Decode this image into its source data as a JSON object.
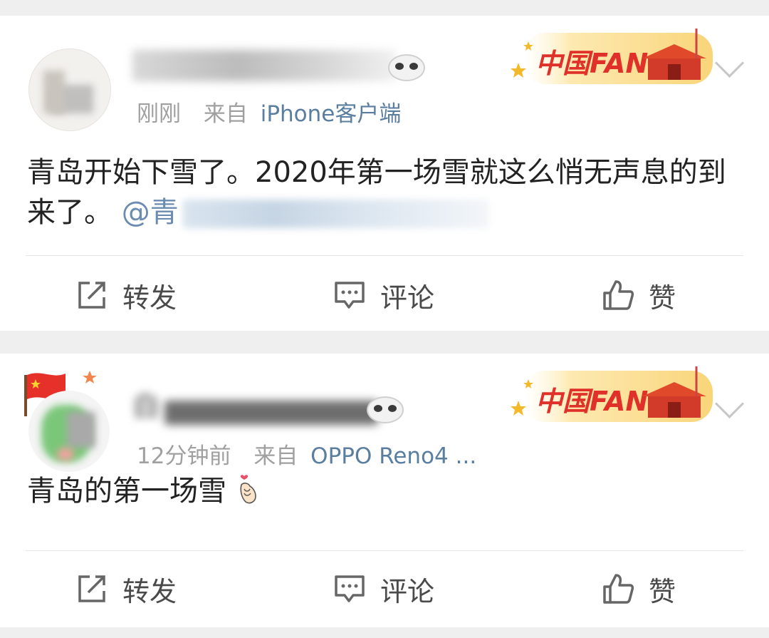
{
  "posts": [
    {
      "time": "刚刚",
      "source_prefix": "来自",
      "source": "iPhone客户端",
      "badge_text": "中国FANS",
      "content_text": "青岛开始下雪了。2020年第一场雪就这么悄无声息的到来了。",
      "mention_prefix": "@青",
      "actions": {
        "repost": "转发",
        "comment": "评论",
        "like": "赞"
      }
    },
    {
      "username_partial": "白",
      "time": "12分钟前",
      "source_prefix": "来自",
      "source": "OPPO Reno4 ...",
      "badge_text": "中国FANS",
      "content_text": "青岛的第一场雪",
      "actions": {
        "repost": "转发",
        "comment": "评论",
        "like": "赞"
      }
    }
  ],
  "colors": {
    "link": "#5a7ea0",
    "meta": "#a0a0a0",
    "badge_text": "#e0302a",
    "badge_bg": "#fbe2a0"
  },
  "icons": [
    "repost-icon",
    "comment-icon",
    "like-icon",
    "chevron-down-icon",
    "flag-icon",
    "heart-hand-emoji"
  ]
}
